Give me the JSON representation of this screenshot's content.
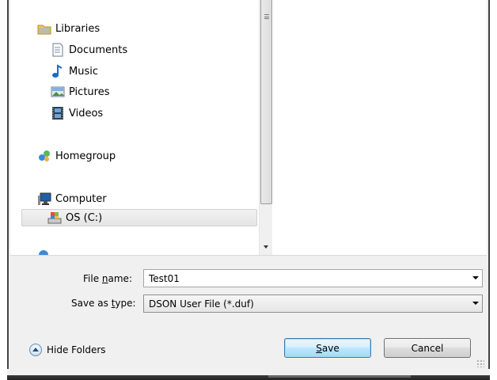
{
  "nav": {
    "items": [
      {
        "label": "Libraries",
        "icon": "libraries-icon"
      },
      {
        "label": "Documents",
        "icon": "documents-icon"
      },
      {
        "label": "Music",
        "icon": "music-icon"
      },
      {
        "label": "Pictures",
        "icon": "pictures-icon"
      },
      {
        "label": "Videos",
        "icon": "videos-icon"
      },
      {
        "label": "Homegroup",
        "icon": "homegroup-icon"
      },
      {
        "label": "Computer",
        "icon": "computer-icon"
      },
      {
        "label": "OS (C:)",
        "icon": "drive-icon",
        "selected": true
      }
    ]
  },
  "form": {
    "filename_label_pre": "File ",
    "filename_label_key": "n",
    "filename_label_post": "ame:",
    "filename_value": "Test01",
    "savetype_label_pre": "Save as ",
    "savetype_label_key": "t",
    "savetype_label_post": "ype:",
    "savetype_value": "DSON User File (*.duf)"
  },
  "actions": {
    "hide_folders": "Hide Folders",
    "save_key": "S",
    "save_rest": "ave",
    "cancel": "Cancel"
  },
  "colors": {
    "accent": "#3c7fb1",
    "panel": "#f0f0f0"
  }
}
